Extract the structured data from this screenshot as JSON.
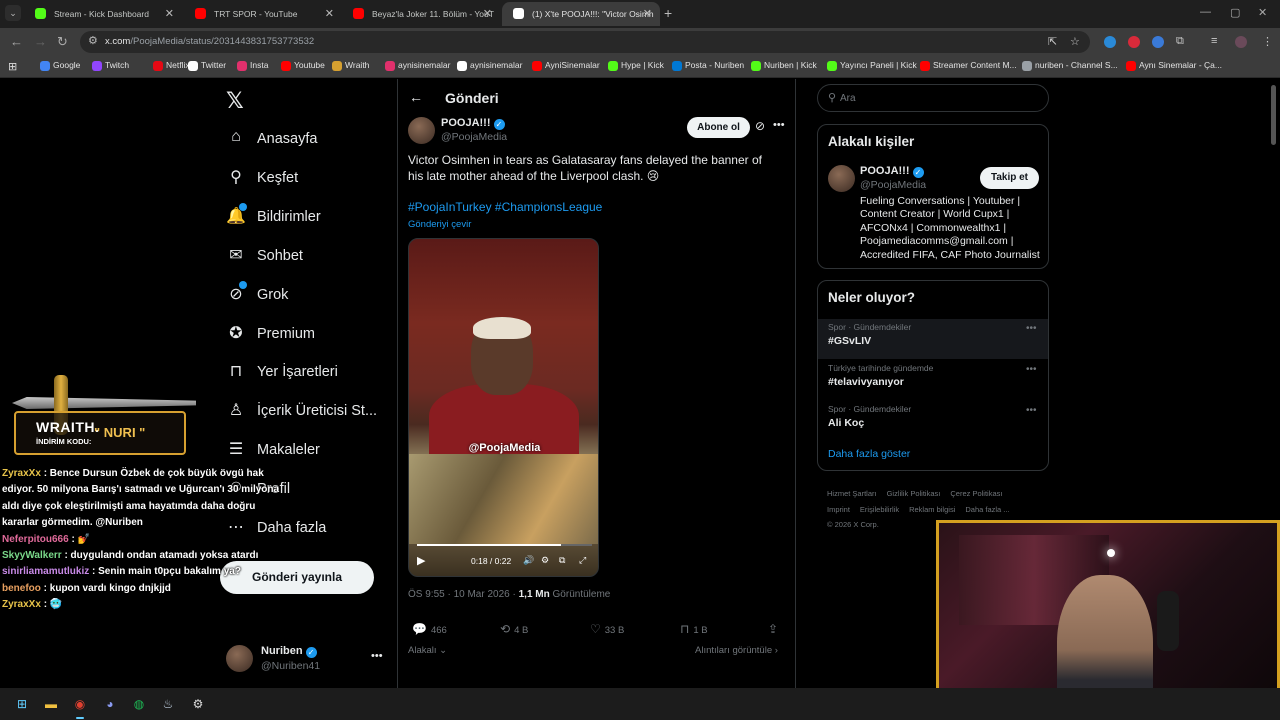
{
  "browser": {
    "tabs": [
      {
        "title": "Stream - Kick Dashboard",
        "color": "#53fc18"
      },
      {
        "title": "TRT SPOR - YouTube",
        "color": "#ff0000"
      },
      {
        "title": "Beyaz'la Joker 11. Bölüm - YouT",
        "color": "#ff0000"
      },
      {
        "title": "(1) X'te POOJA!!!: \"Victor Osimh",
        "color": "#ffffff"
      }
    ],
    "url_host": "x.com",
    "url_path": "/PoojaMedia/status/2031443831753773532",
    "bookmarks": [
      {
        "label": "Google",
        "color": "#4285f4"
      },
      {
        "label": "Twitch",
        "color": "#9146ff"
      },
      {
        "label": "Netflix",
        "color": "#e50914"
      },
      {
        "label": "Twitter",
        "color": "#ffffff"
      },
      {
        "label": "Insta",
        "color": "#e1306c"
      },
      {
        "label": "Youtube",
        "color": "#ff0000"
      },
      {
        "label": "Wraith",
        "color": "#d6a030"
      },
      {
        "label": "aynisinemalar",
        "color": "#e1306c"
      },
      {
        "label": "aynisinemalar",
        "color": "#ffffff"
      },
      {
        "label": "AyniSinemalar",
        "color": "#ff0000"
      },
      {
        "label": "Hype | Kick",
        "color": "#53fc18"
      },
      {
        "label": "Posta - Nuriben",
        "color": "#0078d4"
      },
      {
        "label": "Nuriben | Kick",
        "color": "#53fc18"
      },
      {
        "label": "Yayıncı Paneli | Kick",
        "color": "#53fc18"
      },
      {
        "label": "Streamer Content M...",
        "color": "#ff0000"
      },
      {
        "label": "nuriben - Channel S...",
        "color": "#9aa0a6"
      },
      {
        "label": "Aynı Sinemalar - Ça...",
        "color": "#ff0000"
      }
    ]
  },
  "sidebar": {
    "items": [
      {
        "label": "Anasayfa",
        "icon": "home-icon",
        "glyph": "⌂"
      },
      {
        "label": "Keşfet",
        "icon": "search-icon",
        "glyph": "⚲"
      },
      {
        "label": "Bildirimler",
        "icon": "bell-icon",
        "glyph": "🔔"
      },
      {
        "label": "Sohbet",
        "icon": "mail-icon",
        "glyph": "✉"
      },
      {
        "label": "Grok",
        "icon": "grok-icon",
        "glyph": "⊘"
      },
      {
        "label": "Premium",
        "icon": "premium-icon",
        "glyph": "✪"
      },
      {
        "label": "Yer İşaretleri",
        "icon": "bookmark-icon",
        "glyph": "⊓"
      },
      {
        "label": "İçerik Üreticisi St...",
        "icon": "creator-icon",
        "glyph": "♙"
      },
      {
        "label": "Makaleler",
        "icon": "articles-icon",
        "glyph": "☰"
      },
      {
        "label": "Profil",
        "icon": "profile-icon",
        "glyph": "☺"
      },
      {
        "label": "Daha fazla",
        "icon": "more-circle-icon",
        "glyph": "⋯"
      }
    ],
    "post_button": "Gönderi yayınla",
    "account_name": "Nuriben",
    "account_handle": "@Nuriben41"
  },
  "post": {
    "header": "Gönderi",
    "author_name": "POOJA!!!",
    "author_handle": "@PoojaMedia",
    "subscribe": "Abone ol",
    "text": "Victor Osimhen in tears as Galatasaray fans delayed the banner of his late mother ahead of the Liverpool clash. 😢",
    "hashtags": "#PoojaInTurkey #ChampionsLeague",
    "translate": "Gönderiyi çevir",
    "video_watermark": "@PoojaMedia",
    "video_time": "0:18 / 0:22",
    "video_progress": 0.82,
    "time": "ÖS 9:55 · 10 Mar 2026 · ",
    "views_count": "1,1 Mn",
    "views_label": " Görüntüleme",
    "replies": "466",
    "reposts": "4 B",
    "likes": "33 B",
    "bookmarks": "1 B",
    "related": "Alakalı",
    "quotes": "Alıntıları görüntüle"
  },
  "right": {
    "search_placeholder": "Ara",
    "related_title": "Alakalı kişiler",
    "rp_name": "POOJA!!!",
    "rp_handle": "@PoojaMedia",
    "follow": "Takip et",
    "rp_bio": "Fueling Conversations | Youtuber | Content Creator | World Cupx1 | AFCONx4 | Commonwealthx1 | Poojamediacomms@gmail.com | Accredited FIFA, CAF Photo Journalist",
    "trends_title": "Neler oluyor?",
    "trends": [
      {
        "category": "Spor · Gündemdekiler",
        "title": "#GSvLIV"
      },
      {
        "category": "Türkiye tarihinde gündemde",
        "title": "#telavivyanıyor"
      },
      {
        "category": "Spor · Gündemdekiler",
        "title": "Ali Koç"
      }
    ],
    "show_more": "Daha fazla göster",
    "footer": [
      "Hizmet Şartları",
      "Gizlilik Politikası",
      "Çerez Politikası",
      "Imprint",
      "Erişilebilirlik",
      "Reklam bilgisi",
      "Daha fazla ...",
      "© 2026 X Corp."
    ]
  },
  "overlay": {
    "brand": "WRAITH.",
    "promo": "İNDİRİM KODU:",
    "code": "\" NURI \"",
    "chat": [
      {
        "user": "ZyraxXx",
        "msg": " : Bence Dursun Özbek de çok büyük övgü hak ediyor. 50 milyona Barış'ı satmadı ve Uğurcan'ı 30 milyona aldı diye çok eleştirilmişti ama hayatımda daha doğru kararlar görmedim. @Nuriben"
      },
      {
        "user": "Neferpitou666",
        "msg": " : 💅"
      },
      {
        "user": "SkyyWalkerr",
        "msg": " : duygulandı ondan atamadı yoksa atardı"
      },
      {
        "user": "sinirliamamutlukiz",
        "msg": " : Senin main t0pçu bakalım ya?"
      },
      {
        "user": "benefoo",
        "msg": " : kupon vardı kingo dnjkjjd"
      },
      {
        "user": "ZyraxXx",
        "msg": " : 🥶"
      }
    ]
  }
}
